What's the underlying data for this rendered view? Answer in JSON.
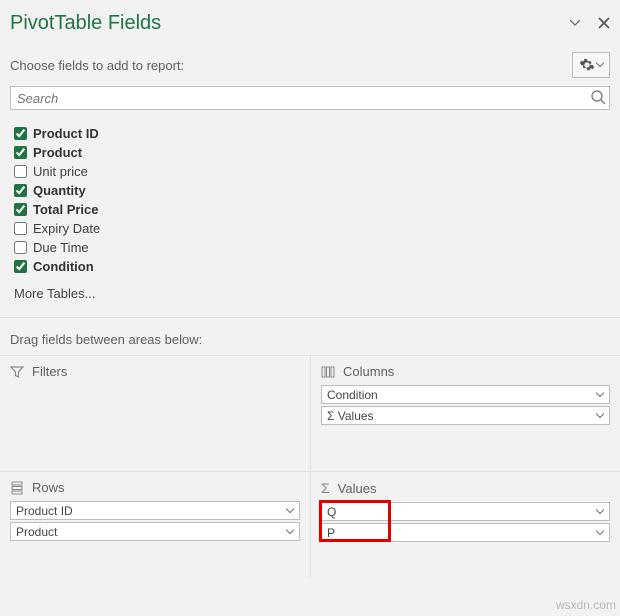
{
  "header": {
    "title": "PivotTable Fields"
  },
  "prompt": "Choose fields to add to report:",
  "search": {
    "placeholder": "Search"
  },
  "fields": [
    {
      "label": "Product ID",
      "checked": true,
      "bold": true
    },
    {
      "label": "Product",
      "checked": true,
      "bold": true
    },
    {
      "label": "Unit price",
      "checked": false,
      "bold": false
    },
    {
      "label": "Quantity",
      "checked": true,
      "bold": true
    },
    {
      "label": "Total Price",
      "checked": true,
      "bold": true
    },
    {
      "label": "Expiry Date",
      "checked": false,
      "bold": false
    },
    {
      "label": "Due Time",
      "checked": false,
      "bold": false
    },
    {
      "label": "Condition",
      "checked": true,
      "bold": true
    }
  ],
  "more_tables": "More Tables...",
  "drag_label": "Drag fields between areas below:",
  "areas": {
    "filters": {
      "label": "Filters",
      "items": []
    },
    "columns": {
      "label": "Columns",
      "items": [
        "Condition",
        "Σ  Values"
      ]
    },
    "rows": {
      "label": "Rows",
      "items": [
        "Product ID",
        "Product"
      ]
    },
    "values": {
      "label": "Values",
      "items": [
        "Q",
        "P"
      ]
    }
  },
  "watermark": "wsxdn.com"
}
